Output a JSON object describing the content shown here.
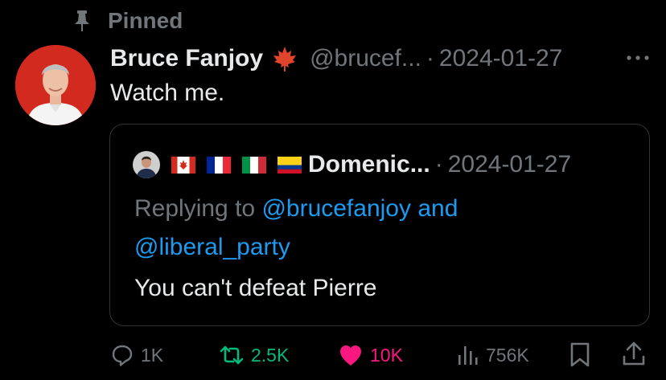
{
  "pinned": {
    "label": "Pinned",
    "icon": "pin-icon"
  },
  "tweet": {
    "author_name": "Bruce Fanjoy",
    "author_emoji": "maple-leaf-icon",
    "handle": "@brucef...",
    "separator": "·",
    "date": "2024-01-27",
    "text": "Watch me."
  },
  "quote": {
    "author_name": "Domenic...",
    "flags": [
      "canada-flag-icon",
      "france-flag-icon",
      "italy-flag-icon",
      "colombia-flag-icon"
    ],
    "separator": "·",
    "date": "2024-01-27",
    "replying_prefix": "Replying to ",
    "mention_1": "@brucefanjoy",
    "and_word": " and",
    "mention_2": "@liberal_party",
    "text": "You can't defeat Pierre"
  },
  "actions": {
    "replies": "1K",
    "reposts": "2.5K",
    "likes": "10K",
    "views": "756K"
  },
  "colors": {
    "background": "#000000",
    "text": "#e7e9ea",
    "muted": "#71767b",
    "link": "#1d9bf0",
    "repost": "#00ba7c",
    "like": "#f91880",
    "border": "#2f3336"
  }
}
